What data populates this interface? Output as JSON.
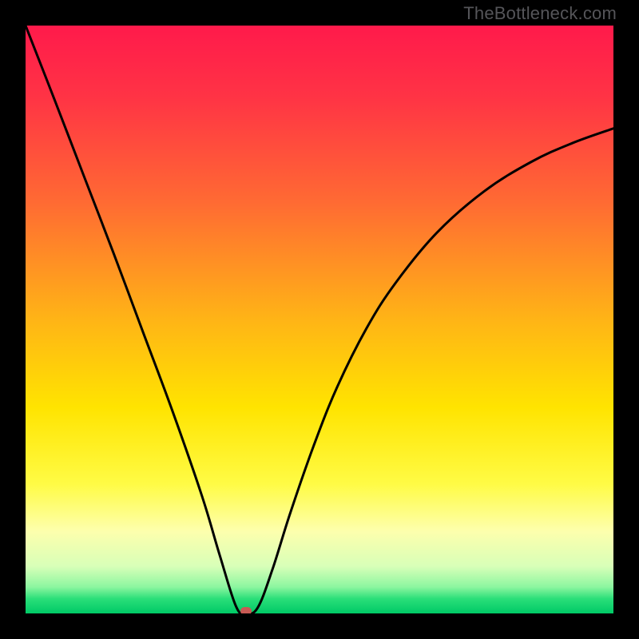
{
  "watermark": "TheBottleneck.com",
  "chart_data": {
    "type": "line",
    "title": "",
    "xlabel": "",
    "ylabel": "",
    "xlim": [
      0,
      1
    ],
    "ylim": [
      0,
      1
    ],
    "gradient_stops": [
      {
        "offset": 0.0,
        "color": "#ff1a4b"
      },
      {
        "offset": 0.12,
        "color": "#ff3345"
      },
      {
        "offset": 0.3,
        "color": "#ff6a33"
      },
      {
        "offset": 0.5,
        "color": "#ffb416"
      },
      {
        "offset": 0.65,
        "color": "#ffe400"
      },
      {
        "offset": 0.78,
        "color": "#fffb45"
      },
      {
        "offset": 0.86,
        "color": "#fdffad"
      },
      {
        "offset": 0.92,
        "color": "#d8ffb8"
      },
      {
        "offset": 0.955,
        "color": "#8cf6a0"
      },
      {
        "offset": 0.975,
        "color": "#2adf79"
      },
      {
        "offset": 1.0,
        "color": "#00c966"
      }
    ],
    "series": [
      {
        "name": "bottleneck-curve",
        "x": [
          0.0,
          0.05,
          0.1,
          0.15,
          0.2,
          0.25,
          0.3,
          0.33,
          0.358,
          0.375,
          0.395,
          0.42,
          0.45,
          0.49,
          0.53,
          0.58,
          0.63,
          0.7,
          0.78,
          0.86,
          0.93,
          1.0
        ],
        "y": [
          1.0,
          0.872,
          0.742,
          0.612,
          0.478,
          0.344,
          0.2,
          0.1,
          0.012,
          0.0,
          0.01,
          0.075,
          0.17,
          0.285,
          0.385,
          0.485,
          0.563,
          0.648,
          0.718,
          0.768,
          0.8,
          0.825
        ]
      }
    ],
    "marker": {
      "x": 0.375,
      "y": 0.0
    }
  }
}
